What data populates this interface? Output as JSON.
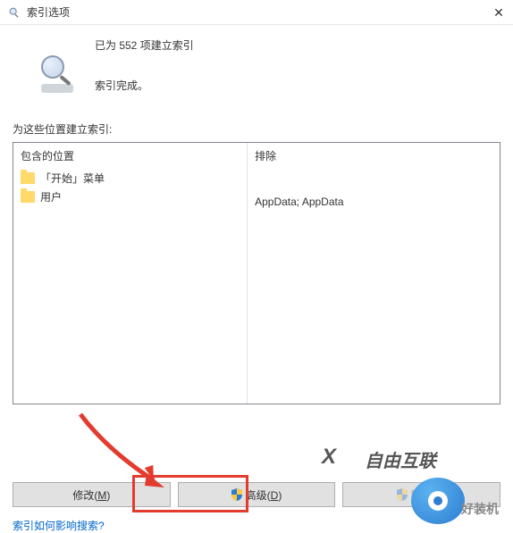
{
  "titlebar": {
    "title": "索引选项"
  },
  "status": {
    "line1": "已为 552 项建立索引",
    "line2": "索引完成。"
  },
  "sectionLabel": "为这些位置建立索引:",
  "columns": {
    "included": "包含的位置",
    "excluded": "排除"
  },
  "includedItems": [
    {
      "label": "「开始」菜单"
    },
    {
      "label": "用户"
    }
  ],
  "excludedText": "AppData; AppData",
  "buttons": {
    "modify": "修改(M)",
    "advanced": "高级(D)",
    "pause": "暂停(P)"
  },
  "helpLink": "索引如何影响搜索?",
  "watermark": {
    "brand1": "自由互联",
    "brand2": "好装机"
  }
}
